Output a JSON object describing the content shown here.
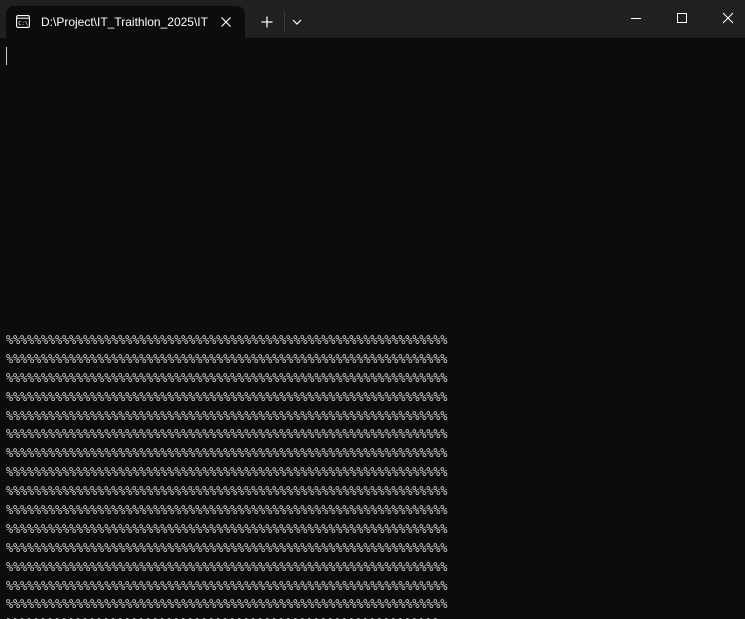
{
  "window": {
    "tab_title": "D:\\Project\\IT_Traithlon_2025\\IT",
    "icons": {
      "tab": "terminal-prompt-icon",
      "tab_close": "close-icon",
      "new_tab": "plus-icon",
      "dropdown": "chevron-down-icon",
      "minimize": "minimize-icon",
      "maximize": "maximize-icon",
      "close": "close-icon"
    }
  },
  "terminal": {
    "prompt_line": "",
    "output_lines": [
      "%%%%%%%%%%%%%%%%%%%%%%%%%%%%%%%%%%%%%%%%%%%%%%%%%%%%%%%%%%%%%%%",
      "%%%%%%%%%%%%%%%%%%%%%%%%%%%%%%%%%%%%%%%%%%%%%%%%%%%%%%%%%%%%%%%",
      "%%%%%%%%%%%%%%%%%%%%%%%%%%%%%%%%%%%%%%%%%%%%%%%%%%%%%%%%%%%%%%%",
      "%%%%%%%%%%%%%%%%%%%%%%%%%%%%%%%%%%%%%%%%%%%%%%%%%%%%%%%%%%%%%%%",
      "%%%%%%%%%%%%%%%%%%%%%%%%%%%%%%%%%%%%%%%%%%%%%%%%%%%%%%%%%%%%%%%",
      "%%%%%%%%%%%%%%%%%%%%%%%%%%%%%%%%%%%%%%%%%%%%%%%%%%%%%%%%%%%%%%%",
      "%%%%%%%%%%%%%%%%%%%%%%%%%%%%%%%%%%%%%%%%%%%%%%%%%%%%%%%%%%%%%%%",
      "%%%%%%%%%%%%%%%%%%%%%%%%%%%%%%%%%%%%%%%%%%%%%%%%%%%%%%%%%%%%%%%",
      "%%%%%%%%%%%%%%%%%%%%%%%%%%%%%%%%%%%%%%%%%%%%%%%%%%%%%%%%%%%%%%%",
      "%%%%%%%%%%%%%%%%%%%%%%%%%%%%%%%%%%%%%%%%%%%%%%%%%%%%%%%%%%%%%%%",
      "%%%%%%%%%%%%%%%%%%%%%%%%%%%%%%%%%%%%%%%%%%%%%%%%%%%%%%%%%%%%%%%",
      "%%%%%%%%%%%%%%%%%%%%%%%%%%%%%%%%%%%%%%%%%%%%%%%%%%%%%%%%%%%%%%%",
      "%%%%%%%%%%%%%%%%%%%%%%%%%%%%%%%%%%%%%%%%%%%%%%%%%%%%%%%%%%%%%%%",
      "%%%%%%%%%%%%%%%%%%%%%%%%%%%%%%%%%%%%%%%%%%%%%%%%%%%%%%%%%%%%%%%",
      "%%%%%%%%%%%%%%%%%%%%%%%%%%%%%%%%%%%%%%%%%%%%%%%%%%%%%%%%%%%%%%%",
      "%%%%%%%%%%%%%%%%%%%%%%%%%%%%%%%%%%%%%%%%%%%%%%%%%%%%%%%%%%%%%%"
    ]
  },
  "colors": {
    "background": "#0c0c0c",
    "titlebar": "#202020",
    "text": "#cccccc",
    "title_text": "#ffffff"
  }
}
